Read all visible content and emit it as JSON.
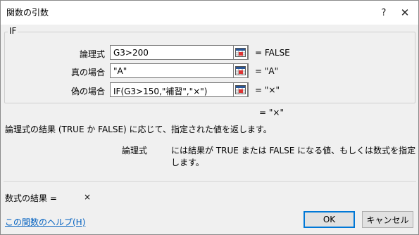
{
  "window": {
    "title": "関数の引数",
    "help_glyph": "?",
    "close_glyph": "✕"
  },
  "function": {
    "name": "IF"
  },
  "arguments": [
    {
      "label": "論理式",
      "value": "G3>200",
      "result": "=  FALSE"
    },
    {
      "label": "真の場合",
      "value": "\"A\"",
      "result": "=  \"A\""
    },
    {
      "label": "偽の場合",
      "value": "IF(G3>150,\"補習\",\"×\")",
      "result": "=  \"×\""
    }
  ],
  "formula_result_inline": "=  \"×\"",
  "description": "論理式の結果 (TRUE か FALSE) に応じて、指定された値を返します。",
  "argument_description": {
    "name": "論理式",
    "text": "には結果が TRUE または FALSE になる値、もしくは数式を指定します。"
  },
  "result": {
    "label": "数式の結果 =",
    "value": "×"
  },
  "help_link": "この関数のヘルプ(H)",
  "buttons": {
    "ok": "OK",
    "cancel": "キャンセル"
  },
  "icons": {
    "ref": "range-select-icon",
    "help": "question-icon",
    "close": "close-icon"
  }
}
